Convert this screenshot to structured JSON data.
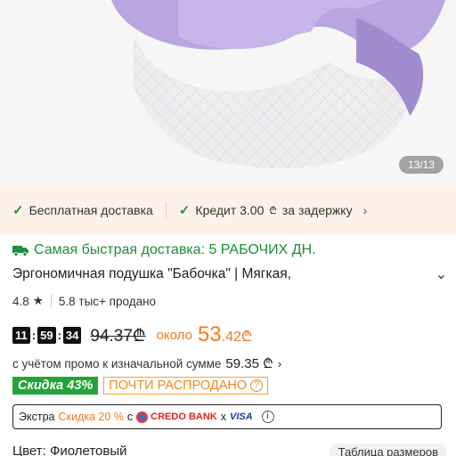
{
  "gallery": {
    "counter": "13/13"
  },
  "perks": {
    "free_delivery": "Бесплатная доставка",
    "credit": "Кредит 3.00",
    "currency": "₾",
    "credit_suffix": "за задержку"
  },
  "delivery": {
    "text": "Самая быстрая доставка: 5 РАБОЧИХ ДН."
  },
  "product": {
    "title": "Эргономичная подушка \"Бабочка\" | Мягкая,",
    "rating": "4.8",
    "sold": "5.8 тыс+ продано"
  },
  "price": {
    "timer_h": "11",
    "timer_m": "59",
    "timer_s": "34",
    "old": "94.37",
    "currency": "₾",
    "about": "около",
    "new_int": "53",
    "new_dec": ".42",
    "promo_text": "с учётом промо к изначальной сумме",
    "promo_amount": "59.35"
  },
  "badges": {
    "discount": "Скидка 43%",
    "soldout": "ПОЧТИ РАСПРОДАНО"
  },
  "extra": {
    "label": "Экстра",
    "discount": "Скидка 20 %",
    "with": "с",
    "bank": "CREDO BANK",
    "x": "x",
    "card": "VISA"
  },
  "variant": {
    "color": "Цвет: Фиолетовый",
    "size_table": "Таблица размеров"
  },
  "colors": {
    "accent_orange": "#f07b1d",
    "green": "#1f9a3c",
    "pillow_purple": "#b9a6e0"
  }
}
